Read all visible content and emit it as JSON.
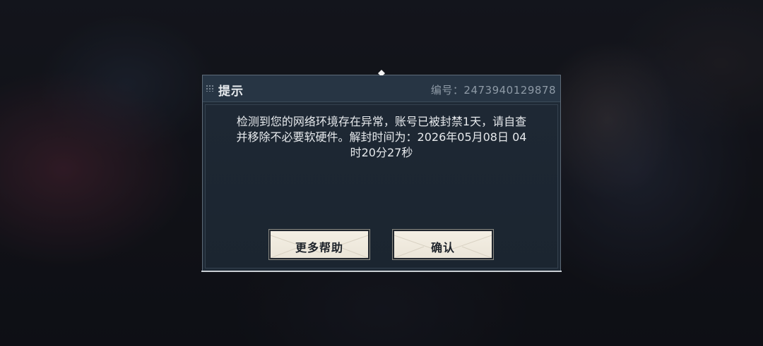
{
  "dialog": {
    "title": "提示",
    "serial": "编号：2473940129878",
    "message_lines": [
      "检测到您的网络环境存在异常，账号已被封禁1天，请自查",
      "并移除不必要软硬件。解封时间为：2026年05月08日 04",
      "时20分27秒"
    ],
    "buttons": {
      "help": "更多帮助",
      "confirm": "确认"
    }
  },
  "colors": {
    "panel": "#1f2a36",
    "titlebar": "#273544",
    "button": "#f1ece1",
    "text": "#e6e9ec"
  }
}
